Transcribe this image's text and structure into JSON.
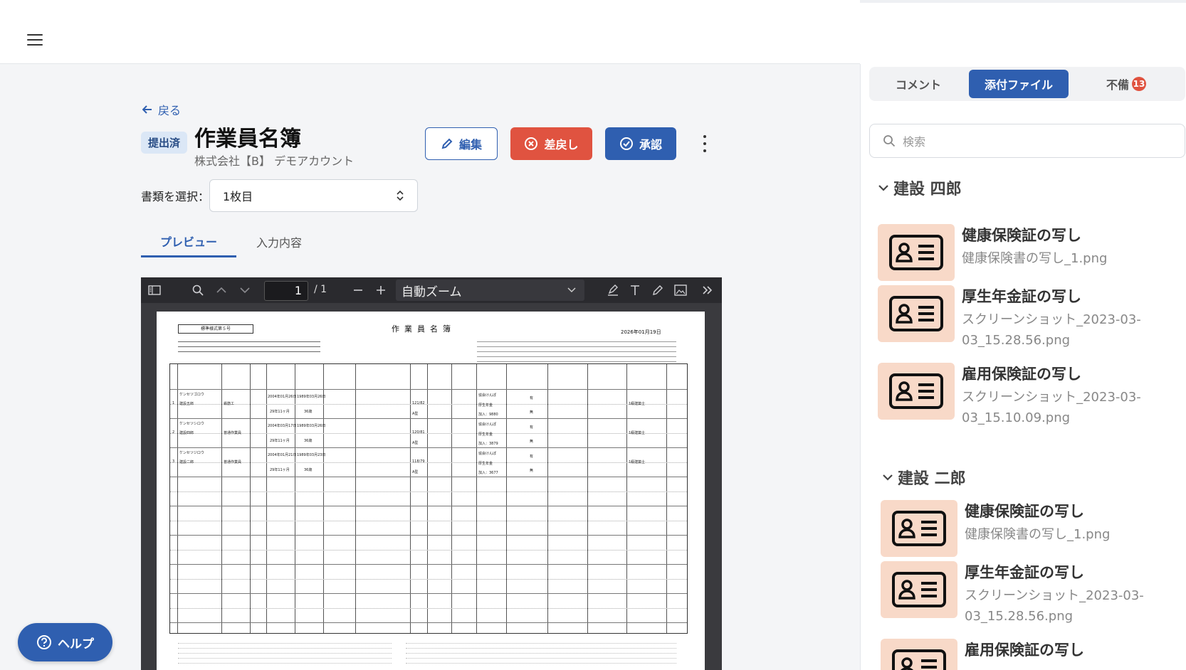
{
  "header": {},
  "page": {
    "back_label": "戻る",
    "status": "提出済",
    "title": "作業員名簿",
    "company": "株式会社【B】 デモアカウント",
    "buttons": {
      "edit": "編集",
      "reject": "差戻し",
      "approve": "承認"
    },
    "doc_select_label": "書類を選択：",
    "doc_select_value": "1枚目",
    "tabs": {
      "preview": "プレビュー",
      "input": "入力内容"
    }
  },
  "pdf": {
    "page_number": "1",
    "page_total": "/ 1",
    "zoom": "自動ズーム",
    "form_code": "標準様式第５号",
    "form_title": "作業員名簿",
    "form_date": "2026年01月19日",
    "rows": [
      {
        "no": "1",
        "furigana": "ケンセツゴロウ",
        "name": "建設五郎",
        "job": "鉄筋工",
        "birth": "2004年01月26日",
        "hire": "1989年03月26日",
        "age": "36歳",
        "exp": "29年11ヶ月",
        "blood": "A型",
        "bp": "121/82",
        "health": "協会けんぽ",
        "pension": "厚生年金",
        "emp": "加入：9880",
        "flag1": "有",
        "flag2": "無",
        "license": "1級建築士"
      },
      {
        "no": "2",
        "furigana": "ケンセツシロウ",
        "name": "建設四郎",
        "job": "普通作業員",
        "birth": "2004年03月17日",
        "hire": "1989年03月26日",
        "age": "36歳",
        "exp": "29年11ヶ月",
        "blood": "A型",
        "bp": "120/81",
        "health": "協会けんぽ",
        "pension": "厚生年金",
        "emp": "加入：3879",
        "flag1": "有",
        "flag2": "無",
        "license": "1級建築士"
      },
      {
        "no": "3",
        "furigana": "ケンセツジロウ",
        "name": "建設二郎",
        "job": "普通作業員",
        "birth": "2004年01月21日",
        "hire": "1989年03月23日",
        "age": "36歳",
        "exp": "29年11ヶ月",
        "blood": "A型",
        "bp": "118/79",
        "health": "協会けんぽ",
        "pension": "厚生年金",
        "emp": "加入：3677",
        "flag1": "有",
        "flag2": "無",
        "license": "1級建築士"
      }
    ]
  },
  "help_label": "ヘルプ",
  "side": {
    "tabs": {
      "comment": "コメント",
      "attachments": "添付ファイル",
      "missing": "不備"
    },
    "missing_count": "13",
    "search_placeholder": "検索",
    "groups": [
      {
        "name": "建設 四郎",
        "items": [
          {
            "title": "健康保険証の写し",
            "file": "健康保険書の写し_1.png"
          },
          {
            "title": "厚生年金証の写し",
            "file": "スクリーンショット_2023-03-03_15.28.56.png"
          },
          {
            "title": "雇用保険証の写し",
            "file": "スクリーンショット_2023-03-03_15.10.09.png"
          }
        ]
      },
      {
        "name": "建設 二郎",
        "items": [
          {
            "title": "健康保険証の写し",
            "file": "健康保険書の写し_1.png"
          },
          {
            "title": "厚生年金証の写し",
            "file": "スクリーンショット_2023-03-03_15.28.56.png"
          },
          {
            "title": "雇用保険証の写し",
            "file": ""
          }
        ]
      }
    ]
  },
  "colors": {
    "primary": "#2f5fb0",
    "danger": "#e05340",
    "badge_bg": "#dbe7f6",
    "thumb_bg": "#f8d9c8"
  }
}
